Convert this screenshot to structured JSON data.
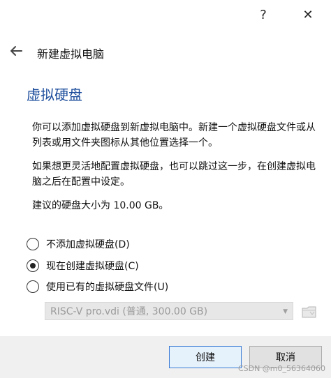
{
  "titlebar": {
    "help_label": "?",
    "close_label": "✕"
  },
  "wizard": {
    "title": "新建虚拟电脑"
  },
  "page": {
    "title": "虚拟硬盘",
    "para1": "你可以添加虚拟硬盘到新虚拟电脑中。新建一个虚拟硬盘文件或从列表或用文件夹图标从其他位置选择一个。",
    "para2": "如果想更灵活地配置虚拟硬盘，也可以跳过这一步，在创建虚拟电脑之后在配置中设定。",
    "para3": "建议的硬盘大小为 10.00 GB。"
  },
  "options": [
    {
      "label": "不添加虚拟硬盘(D)",
      "selected": false
    },
    {
      "label": "现在创建虚拟硬盘(C)",
      "selected": true
    },
    {
      "label": "使用已有的虚拟硬盘文件(U)",
      "selected": false
    }
  ],
  "existing_disk": {
    "selected_value": "RISC-V pro.vdi (普通, 300.00 GB)",
    "arrow": "▼"
  },
  "buttons": {
    "create": "创建",
    "cancel": "取消"
  },
  "watermark": "CSDN @m0_56364060"
}
